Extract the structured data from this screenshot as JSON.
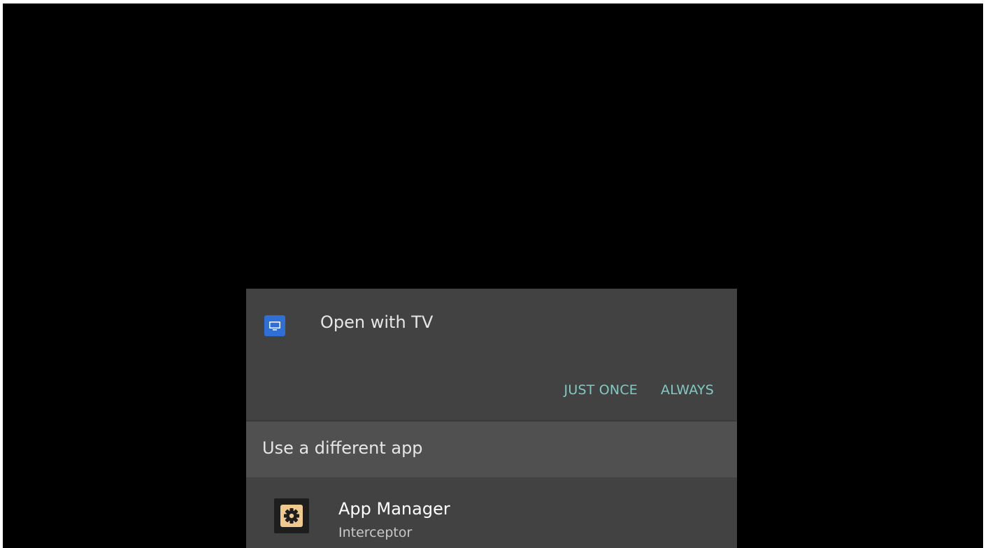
{
  "dialog": {
    "title": "Open with TV",
    "title_icon": "tv-icon",
    "actions": {
      "just_once": "JUST ONCE",
      "always": "ALWAYS"
    },
    "section_title": "Use a different app",
    "apps": [
      {
        "name": "App Manager",
        "subtitle": "Interceptor",
        "icon": "gear-icon"
      }
    ]
  },
  "colors": {
    "background": "#000000",
    "sheet": "#424242",
    "section_header": "#505050",
    "accent": "#7fcbc4",
    "tv_icon": "#2f6fd6",
    "app_icon": "#f0c98f"
  }
}
